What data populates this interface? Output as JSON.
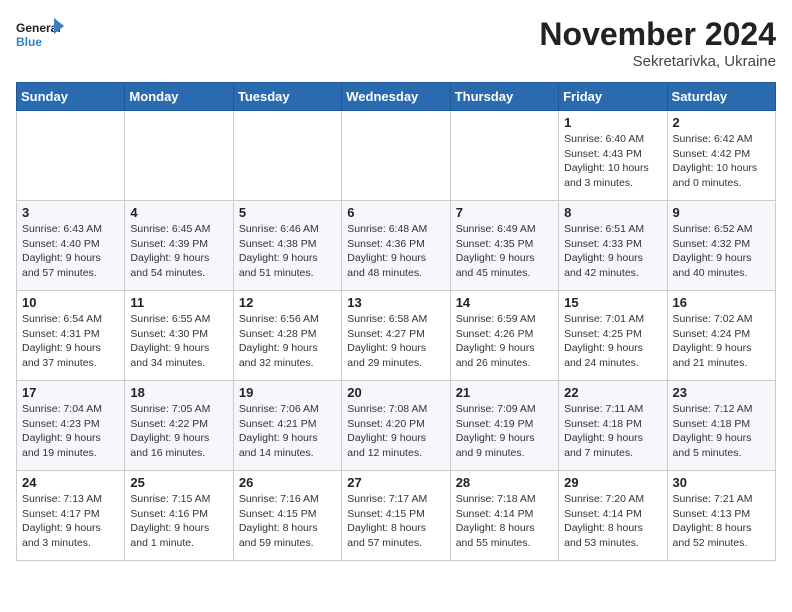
{
  "logo": {
    "line1": "General",
    "line2": "Blue"
  },
  "title": "November 2024",
  "subtitle": "Sekretarivka, Ukraine",
  "days_of_week": [
    "Sunday",
    "Monday",
    "Tuesday",
    "Wednesday",
    "Thursday",
    "Friday",
    "Saturday"
  ],
  "weeks": [
    [
      {
        "day": "",
        "info": ""
      },
      {
        "day": "",
        "info": ""
      },
      {
        "day": "",
        "info": ""
      },
      {
        "day": "",
        "info": ""
      },
      {
        "day": "",
        "info": ""
      },
      {
        "day": "1",
        "info": "Sunrise: 6:40 AM\nSunset: 4:43 PM\nDaylight: 10 hours\nand 3 minutes."
      },
      {
        "day": "2",
        "info": "Sunrise: 6:42 AM\nSunset: 4:42 PM\nDaylight: 10 hours\nand 0 minutes."
      }
    ],
    [
      {
        "day": "3",
        "info": "Sunrise: 6:43 AM\nSunset: 4:40 PM\nDaylight: 9 hours\nand 57 minutes."
      },
      {
        "day": "4",
        "info": "Sunrise: 6:45 AM\nSunset: 4:39 PM\nDaylight: 9 hours\nand 54 minutes."
      },
      {
        "day": "5",
        "info": "Sunrise: 6:46 AM\nSunset: 4:38 PM\nDaylight: 9 hours\nand 51 minutes."
      },
      {
        "day": "6",
        "info": "Sunrise: 6:48 AM\nSunset: 4:36 PM\nDaylight: 9 hours\nand 48 minutes."
      },
      {
        "day": "7",
        "info": "Sunrise: 6:49 AM\nSunset: 4:35 PM\nDaylight: 9 hours\nand 45 minutes."
      },
      {
        "day": "8",
        "info": "Sunrise: 6:51 AM\nSunset: 4:33 PM\nDaylight: 9 hours\nand 42 minutes."
      },
      {
        "day": "9",
        "info": "Sunrise: 6:52 AM\nSunset: 4:32 PM\nDaylight: 9 hours\nand 40 minutes."
      }
    ],
    [
      {
        "day": "10",
        "info": "Sunrise: 6:54 AM\nSunset: 4:31 PM\nDaylight: 9 hours\nand 37 minutes."
      },
      {
        "day": "11",
        "info": "Sunrise: 6:55 AM\nSunset: 4:30 PM\nDaylight: 9 hours\nand 34 minutes."
      },
      {
        "day": "12",
        "info": "Sunrise: 6:56 AM\nSunset: 4:28 PM\nDaylight: 9 hours\nand 32 minutes."
      },
      {
        "day": "13",
        "info": "Sunrise: 6:58 AM\nSunset: 4:27 PM\nDaylight: 9 hours\nand 29 minutes."
      },
      {
        "day": "14",
        "info": "Sunrise: 6:59 AM\nSunset: 4:26 PM\nDaylight: 9 hours\nand 26 minutes."
      },
      {
        "day": "15",
        "info": "Sunrise: 7:01 AM\nSunset: 4:25 PM\nDaylight: 9 hours\nand 24 minutes."
      },
      {
        "day": "16",
        "info": "Sunrise: 7:02 AM\nSunset: 4:24 PM\nDaylight: 9 hours\nand 21 minutes."
      }
    ],
    [
      {
        "day": "17",
        "info": "Sunrise: 7:04 AM\nSunset: 4:23 PM\nDaylight: 9 hours\nand 19 minutes."
      },
      {
        "day": "18",
        "info": "Sunrise: 7:05 AM\nSunset: 4:22 PM\nDaylight: 9 hours\nand 16 minutes."
      },
      {
        "day": "19",
        "info": "Sunrise: 7:06 AM\nSunset: 4:21 PM\nDaylight: 9 hours\nand 14 minutes."
      },
      {
        "day": "20",
        "info": "Sunrise: 7:08 AM\nSunset: 4:20 PM\nDaylight: 9 hours\nand 12 minutes."
      },
      {
        "day": "21",
        "info": "Sunrise: 7:09 AM\nSunset: 4:19 PM\nDaylight: 9 hours\nand 9 minutes."
      },
      {
        "day": "22",
        "info": "Sunrise: 7:11 AM\nSunset: 4:18 PM\nDaylight: 9 hours\nand 7 minutes."
      },
      {
        "day": "23",
        "info": "Sunrise: 7:12 AM\nSunset: 4:18 PM\nDaylight: 9 hours\nand 5 minutes."
      }
    ],
    [
      {
        "day": "24",
        "info": "Sunrise: 7:13 AM\nSunset: 4:17 PM\nDaylight: 9 hours\nand 3 minutes."
      },
      {
        "day": "25",
        "info": "Sunrise: 7:15 AM\nSunset: 4:16 PM\nDaylight: 9 hours\nand 1 minute."
      },
      {
        "day": "26",
        "info": "Sunrise: 7:16 AM\nSunset: 4:15 PM\nDaylight: 8 hours\nand 59 minutes."
      },
      {
        "day": "27",
        "info": "Sunrise: 7:17 AM\nSunset: 4:15 PM\nDaylight: 8 hours\nand 57 minutes."
      },
      {
        "day": "28",
        "info": "Sunrise: 7:18 AM\nSunset: 4:14 PM\nDaylight: 8 hours\nand 55 minutes."
      },
      {
        "day": "29",
        "info": "Sunrise: 7:20 AM\nSunset: 4:14 PM\nDaylight: 8 hours\nand 53 minutes."
      },
      {
        "day": "30",
        "info": "Sunrise: 7:21 AM\nSunset: 4:13 PM\nDaylight: 8 hours\nand 52 minutes."
      }
    ]
  ]
}
